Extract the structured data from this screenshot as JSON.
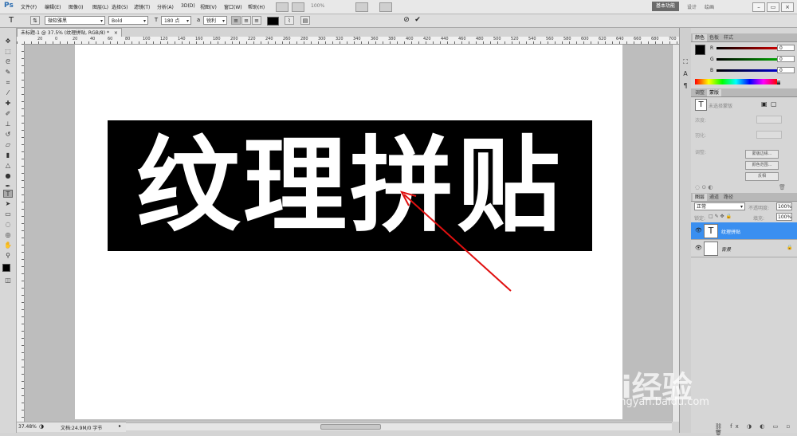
{
  "app": {
    "logo": "Ps",
    "workspace_button": "基本功能",
    "workspace_tabs": [
      "设计",
      "绘画"
    ]
  },
  "menu": [
    "文件(F)",
    "编辑(E)",
    "图像(I)",
    "图层(L)",
    "选择(S)",
    "滤镜(T)",
    "分析(A)",
    "3D(D)",
    "视图(V)",
    "窗口(W)",
    "帮助(H)"
  ],
  "toolbar": {
    "zoom": "100%"
  },
  "options": {
    "font_family": "微软雅黑",
    "font_style": "Bold",
    "font_size": "180 点",
    "antialias": "锐利",
    "text_color": "#000000"
  },
  "document": {
    "tab_title": "未标题-1 @ 37.5% (纹理拼贴, RGB/8) *",
    "ruler_ticks": [
      "20",
      "0",
      "20",
      "40",
      "60",
      "80",
      "100",
      "120",
      "140",
      "160",
      "180",
      "200",
      "220",
      "240",
      "260",
      "280",
      "300",
      "320",
      "340",
      "360",
      "380",
      "400",
      "420",
      "440",
      "460",
      "480",
      "500",
      "520",
      "540",
      "560",
      "580",
      "600",
      "620",
      "640",
      "660",
      "680",
      "700"
    ],
    "canvas_text": "纹理拼贴",
    "text_bg": "#000000",
    "text_color": "#ffffff"
  },
  "status": {
    "zoom": "37.48%",
    "doc_info": "文档:24.9M/0 字节"
  },
  "panels": {
    "color_tabs": [
      "颜色",
      "色板",
      "样式"
    ],
    "color": {
      "r": "0",
      "g": "0",
      "b": "0",
      "r_label": "R",
      "g_label": "G",
      "b_label": "B"
    },
    "adjust_tabs": [
      "调整",
      "蒙版"
    ],
    "mask": {
      "title": "未选择蒙版",
      "density": "浓度:",
      "feather": "羽化:",
      "refine": "调整:",
      "btn_edge": "蒙版边缘...",
      "btn_color": "颜色范围...",
      "btn_invert": "反相"
    },
    "layers_tabs": [
      "图层",
      "通道",
      "路径"
    ],
    "layers": {
      "blend_mode": "正常",
      "opacity_label": "不透明度:",
      "opacity": "100%",
      "lock_label": "锁定:",
      "fill_label": "填充:",
      "fill": "100%",
      "items": [
        {
          "name": "纹理拼贴",
          "thumb": "T",
          "selected": true
        },
        {
          "name": "背景",
          "thumb": "",
          "selected": false
        }
      ]
    }
  },
  "watermark": {
    "logo": "Bai经验",
    "url": "jingyan.baidu.com"
  }
}
